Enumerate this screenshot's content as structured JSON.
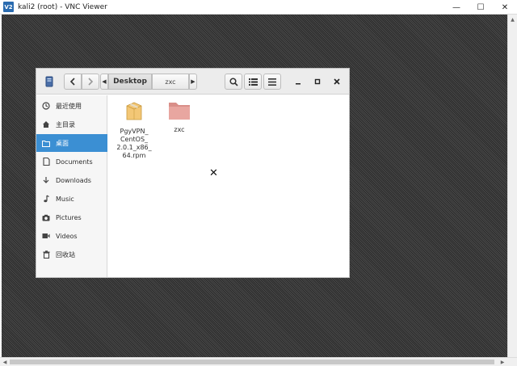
{
  "vnc": {
    "title": "kali2 (root) - VNC Viewer",
    "icon_text": "V2",
    "minimize": "—",
    "maximize": "☐",
    "close": "✕"
  },
  "file_manager": {
    "path": {
      "current": "Desktop",
      "child": "zxc"
    },
    "sidebar": {
      "items": [
        {
          "label": "最近使用",
          "icon": "clock-icon"
        },
        {
          "label": "主目录",
          "icon": "home-icon"
        },
        {
          "label": "桌面",
          "icon": "folder-icon",
          "active": true
        },
        {
          "label": "Documents",
          "icon": "document-icon"
        },
        {
          "label": "Downloads",
          "icon": "download-icon"
        },
        {
          "label": "Music",
          "icon": "music-icon"
        },
        {
          "label": "Pictures",
          "icon": "camera-icon"
        },
        {
          "label": "Videos",
          "icon": "video-icon"
        },
        {
          "label": "回收站",
          "icon": "trash-icon"
        }
      ]
    },
    "files": [
      {
        "name": "PgyVPN_ CentOS_ 2.0.1_x86_ 64.rpm",
        "icon": "package-icon"
      },
      {
        "name": "zxc",
        "icon": "folder-icon"
      }
    ],
    "colors": {
      "selection": "#3b8fd3",
      "folder": "#e8a6a0",
      "package": "#f3c776"
    }
  }
}
